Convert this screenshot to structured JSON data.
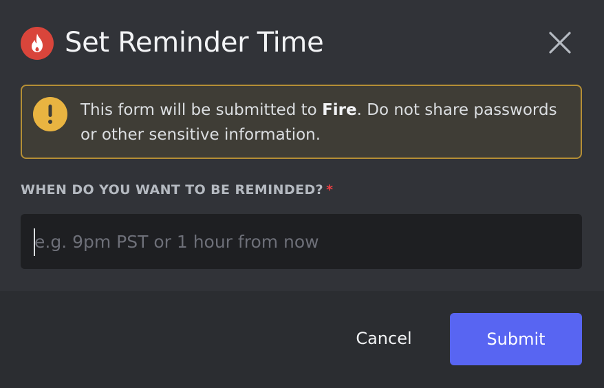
{
  "modal": {
    "title": "Set Reminder Time",
    "app_icon": "flame-icon",
    "close_icon": "close-icon"
  },
  "warning": {
    "icon": "exclamation-icon",
    "text_prefix": "This form will be submitted to ",
    "app_name": "Fire",
    "text_suffix": ". Do not share passwords or other sensitive information."
  },
  "form": {
    "field_label": "WHEN DO YOU WANT TO BE REMINDED?",
    "required_marker": "*",
    "input_value": "",
    "input_placeholder": "e.g. 9pm PST or 1 hour from now"
  },
  "footer": {
    "cancel_label": "Cancel",
    "submit_label": "Submit"
  },
  "colors": {
    "background": "#313338",
    "footer_background": "#2b2d31",
    "input_background": "#1e1f22",
    "primary_button": "#5865f2",
    "warning_border": "#b58f35",
    "warning_icon": "#e9b441",
    "app_icon": "#d9453b",
    "required": "#f23f43"
  }
}
